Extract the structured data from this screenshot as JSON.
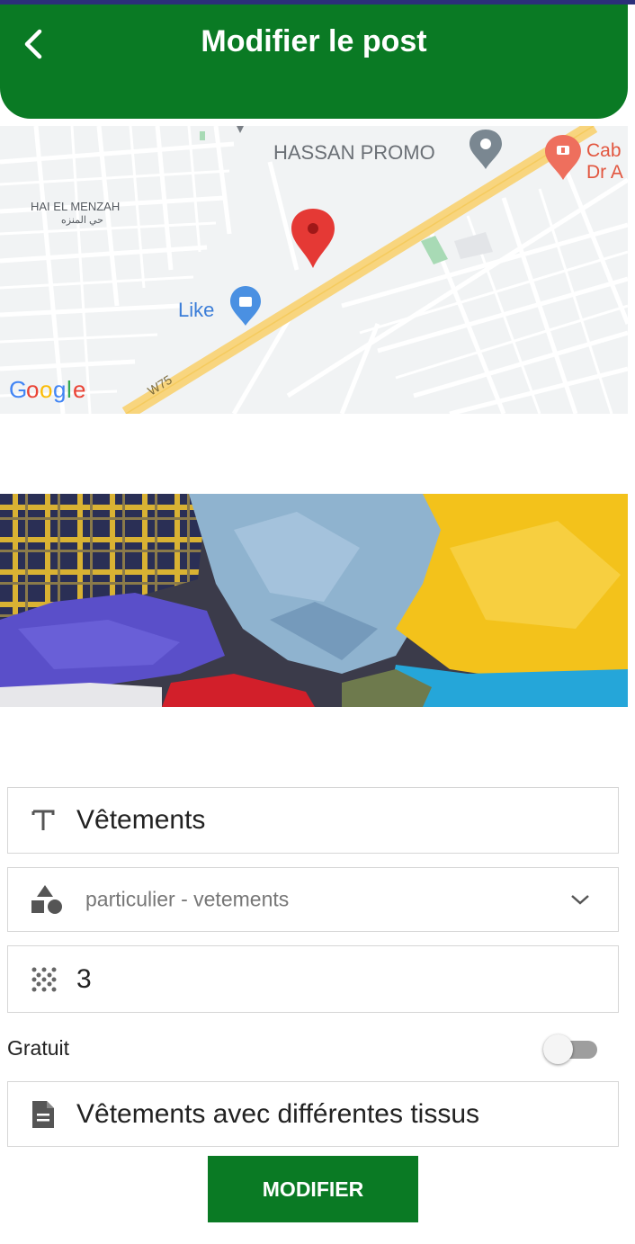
{
  "header": {
    "title": "Modifier le post",
    "back_icon": "arrow-back-icon",
    "color": "#0a7a24"
  },
  "map": {
    "labels": {
      "hassan_promo": "HASSAN PROMO",
      "hai_el_menzah": "HAI EL MENZAH",
      "hai_el_menzah_ar": "حي المنزه",
      "cab_line1": "Cab",
      "cab_line2": "Dr A",
      "like": "Like",
      "road": "W75",
      "google": "Google"
    },
    "marker_icon": "location-pin-icon"
  },
  "form": {
    "title_field": {
      "icon": "text-title-icon",
      "value": "Vêtements"
    },
    "category_field": {
      "icon": "category-shapes-icon",
      "value": "particulier - vetements"
    },
    "quantity_field": {
      "icon": "grain-dots-icon",
      "value": "3"
    },
    "gratuit": {
      "label": "Gratuit",
      "enabled": false
    },
    "description_field": {
      "icon": "document-icon",
      "value": "Vêtements avec différentes tissus"
    },
    "submit_label": "MODIFIER"
  }
}
